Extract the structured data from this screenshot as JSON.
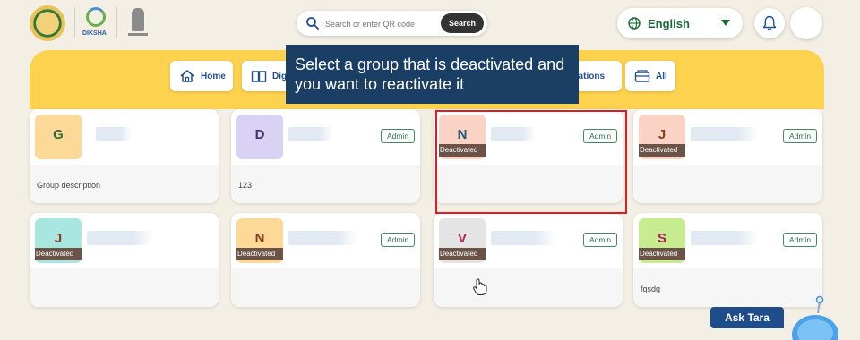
{
  "header": {
    "logo_label": "DIKSHA",
    "search": {
      "placeholder": "Search or enter QR code",
      "button_label": "Search"
    },
    "language": {
      "selected": "English"
    }
  },
  "nav": {
    "tabs": [
      {
        "label": "Home",
        "icon": "home-icon"
      },
      {
        "label": "Dig",
        "icon": "book-icon"
      },
      {
        "label": "vations",
        "icon": "lightbulb-icon"
      },
      {
        "label": "All",
        "icon": "folder-icon"
      }
    ]
  },
  "tooltip": {
    "text": "Select a group that is deactivated and you want to reactivate it"
  },
  "groups": [
    {
      "letter": "G",
      "status": "",
      "role": "",
      "description": "Group description",
      "avatar_color": "#fcd996",
      "letter_color": "#2e6b3e"
    },
    {
      "letter": "D",
      "status": "",
      "role": "Admin",
      "description": "123",
      "avatar_color": "#d9d2f5",
      "letter_color": "#3d3468"
    },
    {
      "letter": "N",
      "status": "Deactivated",
      "role": "Admin",
      "description": "",
      "avatar_color": "#fbd3c4",
      "letter_color": "#1e5a7a"
    },
    {
      "letter": "J",
      "status": "Deactivated",
      "role": "Admin",
      "description": "",
      "avatar_color": "#fbd3c4",
      "letter_color": "#8b3b1e"
    },
    {
      "letter": "J",
      "status": "Deactivated",
      "role": "",
      "description": "",
      "avatar_color": "#a8e6e0",
      "letter_color": "#8b3b1e"
    },
    {
      "letter": "N",
      "status": "Deactivated",
      "role": "Admin",
      "description": "",
      "avatar_color": "#fcd996",
      "letter_color": "#8b3b1e"
    },
    {
      "letter": "V",
      "status": "Deactivated",
      "role": "Admin",
      "description": "",
      "avatar_color": "#e4e4e4",
      "letter_color": "#b01c58"
    },
    {
      "letter": "S",
      "status": "Deactivated",
      "role": "Admin",
      "description": "fgsdg",
      "avatar_color": "#c7ec8f",
      "letter_color": "#b01c58"
    }
  ],
  "assistant": {
    "label": "Ask Tara"
  },
  "colors": {
    "accent_yellow": "#fdd24f",
    "brand_blue": "#1f4d8c",
    "tooltip_bg": "#1a3e64",
    "highlight_red": "#e01b24"
  }
}
